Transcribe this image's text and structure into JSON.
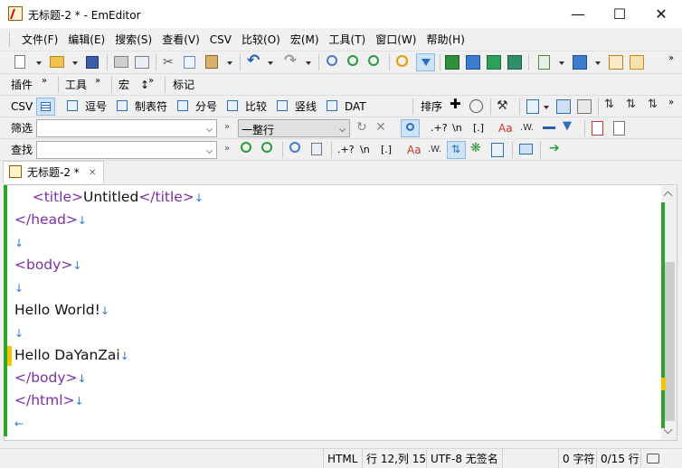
{
  "window": {
    "title": "无标题-2 * - EmEditor",
    "minimize": "—",
    "maximize": "☐",
    "close": "✕"
  },
  "menu": [
    "文件(F)",
    "编辑(E)",
    "搜索(S)",
    "查看(V)",
    "CSV",
    "比较(O)",
    "宏(M)",
    "工具(T)",
    "窗口(W)",
    "帮助(H)"
  ],
  "toolbar_labels": {
    "plugins": "插件",
    "tools": "工具",
    "macros": "宏",
    "macros_suffix": "↕",
    "markers": "标记"
  },
  "csv_bar": {
    "csv": "CSV",
    "comma": "逗号",
    "tab": "制表符",
    "semicolon": "分号",
    "compare": "比较",
    "pipe": "竖线",
    "dat": "DAT",
    "sort": "排序"
  },
  "filter_bar": {
    "label": "筛选",
    "value": "",
    "scope_value": "一整行",
    "regex_hint": ".+?",
    "newline_hint": "\\n",
    "bracket_hint": "[.]",
    "case_hint": "Aa",
    "word_hint": ".W."
  },
  "find_bar": {
    "label": "查找",
    "value": "",
    "regex_hint": ".+?",
    "newline_hint": "\\n",
    "bracket_hint": "[.]",
    "case_hint": "Aa",
    "word_hint": ".W."
  },
  "tab": {
    "title": "无标题-2 *",
    "close": "✕"
  },
  "editor": {
    "lines": [
      {
        "indent": "    ",
        "open": "<title>",
        "text": "Untitled",
        "close": "</title>",
        "eol": "↓"
      },
      {
        "indent": "",
        "open": "</head>",
        "text": "",
        "close": "",
        "eol": "↓"
      },
      {
        "indent": "",
        "open": "",
        "text": "",
        "close": "",
        "eol": "↓"
      },
      {
        "indent": "",
        "open": "<body>",
        "text": "",
        "close": "",
        "eol": "↓"
      },
      {
        "indent": "",
        "open": "",
        "text": "",
        "close": "",
        "eol": "↓"
      },
      {
        "indent": "",
        "open": "",
        "text": "Hello World!",
        "close": "",
        "eol": "↓"
      },
      {
        "indent": "",
        "open": "",
        "text": "",
        "close": "",
        "eol": "↓"
      },
      {
        "indent": "",
        "open": "",
        "text": "Hello DaYanZai",
        "close": "",
        "eol": "↓"
      },
      {
        "indent": "",
        "open": "</body>",
        "text": "",
        "close": "",
        "eol": "↓"
      },
      {
        "indent": "",
        "open": "</html>",
        "text": "",
        "close": "",
        "eol": "↓"
      },
      {
        "indent": "",
        "open": "",
        "text": "",
        "close": "",
        "eol": "←"
      }
    ],
    "modified_line": 8
  },
  "status": {
    "mode": "HTML",
    "position": "行 12,列 15",
    "encoding": "UTF-8 无签名",
    "chars": "0 字符",
    "lines": "0/15 行"
  },
  "colors": {
    "tag": "#7b2ea8",
    "eol": "#2e7bd6",
    "modified_marker": "#f5c400",
    "gutter": "#2aa52a"
  }
}
